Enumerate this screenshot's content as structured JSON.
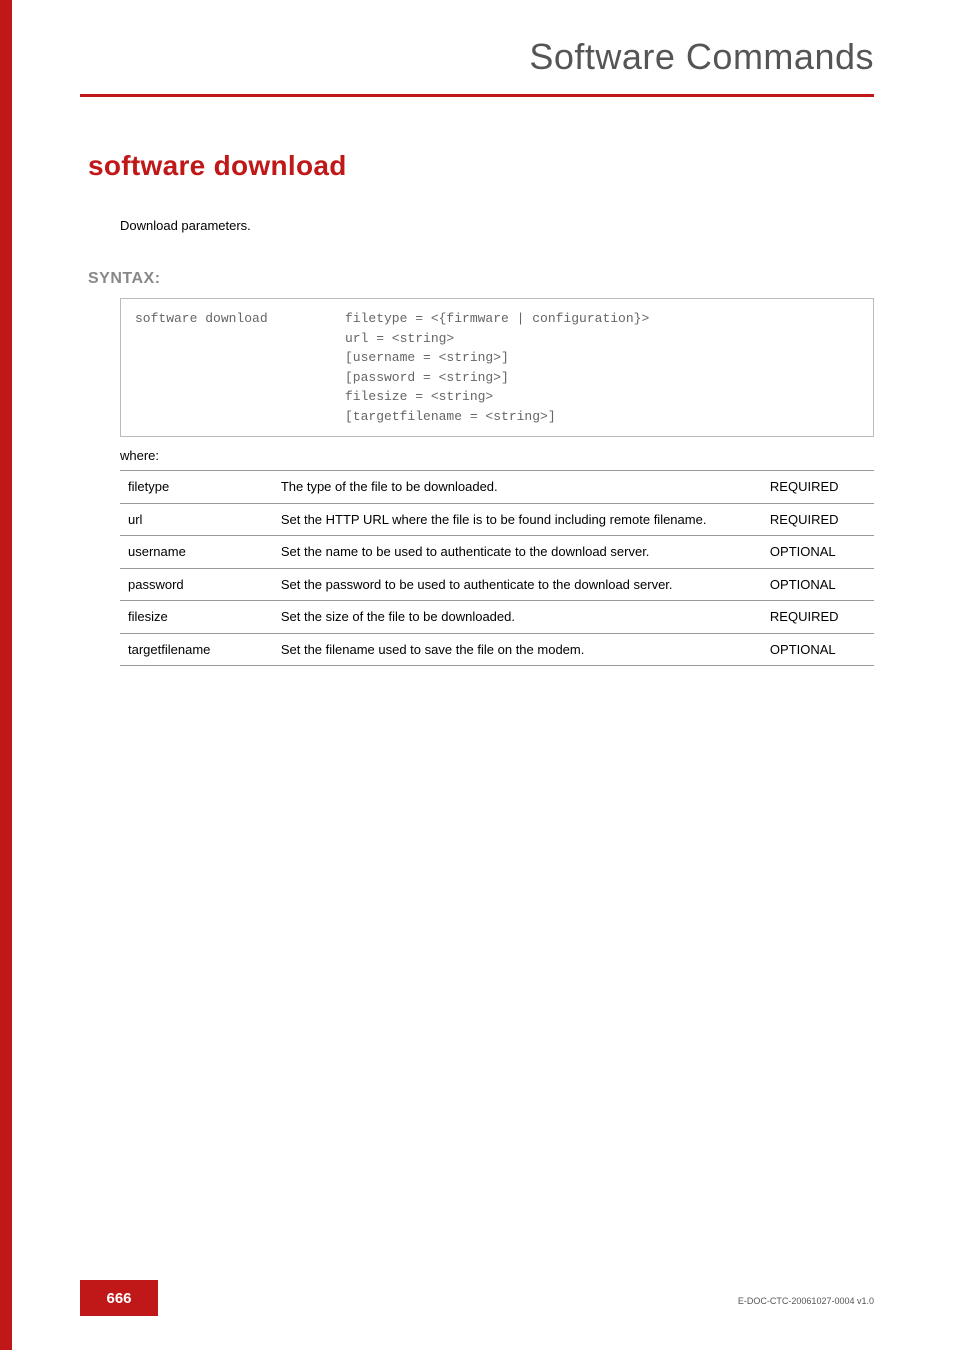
{
  "header": {
    "title": "Software Commands"
  },
  "section": {
    "title": "software download",
    "description": "Download parameters."
  },
  "syntax": {
    "label": "SYNTAX:",
    "command": "software download",
    "args_line1": "filetype = <{firmware | configuration}>",
    "args_line2": "url = <string>",
    "args_line3": "[username = <string>]",
    "args_line4": "[password = <string>]",
    "args_line5": "filesize = <string>",
    "args_line6": "[targetfilename = <string>]"
  },
  "where_label": "where:",
  "params": [
    {
      "name": "filetype",
      "desc": "The type of the file to be downloaded.",
      "req": "REQUIRED"
    },
    {
      "name": "url",
      "desc": "Set the HTTP URL where the file is to be found including remote filename.",
      "req": "REQUIRED"
    },
    {
      "name": "username",
      "desc": "Set the name to be used to authenticate to the download server.",
      "req": "OPTIONAL"
    },
    {
      "name": "password",
      "desc": "Set the password to be used to authenticate to the download server.",
      "req": "OPTIONAL"
    },
    {
      "name": "filesize",
      "desc": "Set the size of the file to be downloaded.",
      "req": "REQUIRED"
    },
    {
      "name": "targetfilename",
      "desc": "Set the filename used to save the file on the modem.",
      "req": "OPTIONAL"
    }
  ],
  "footer": {
    "page_number": "666",
    "doc_id": "E-DOC-CTC-20061027-0004 v1.0"
  }
}
